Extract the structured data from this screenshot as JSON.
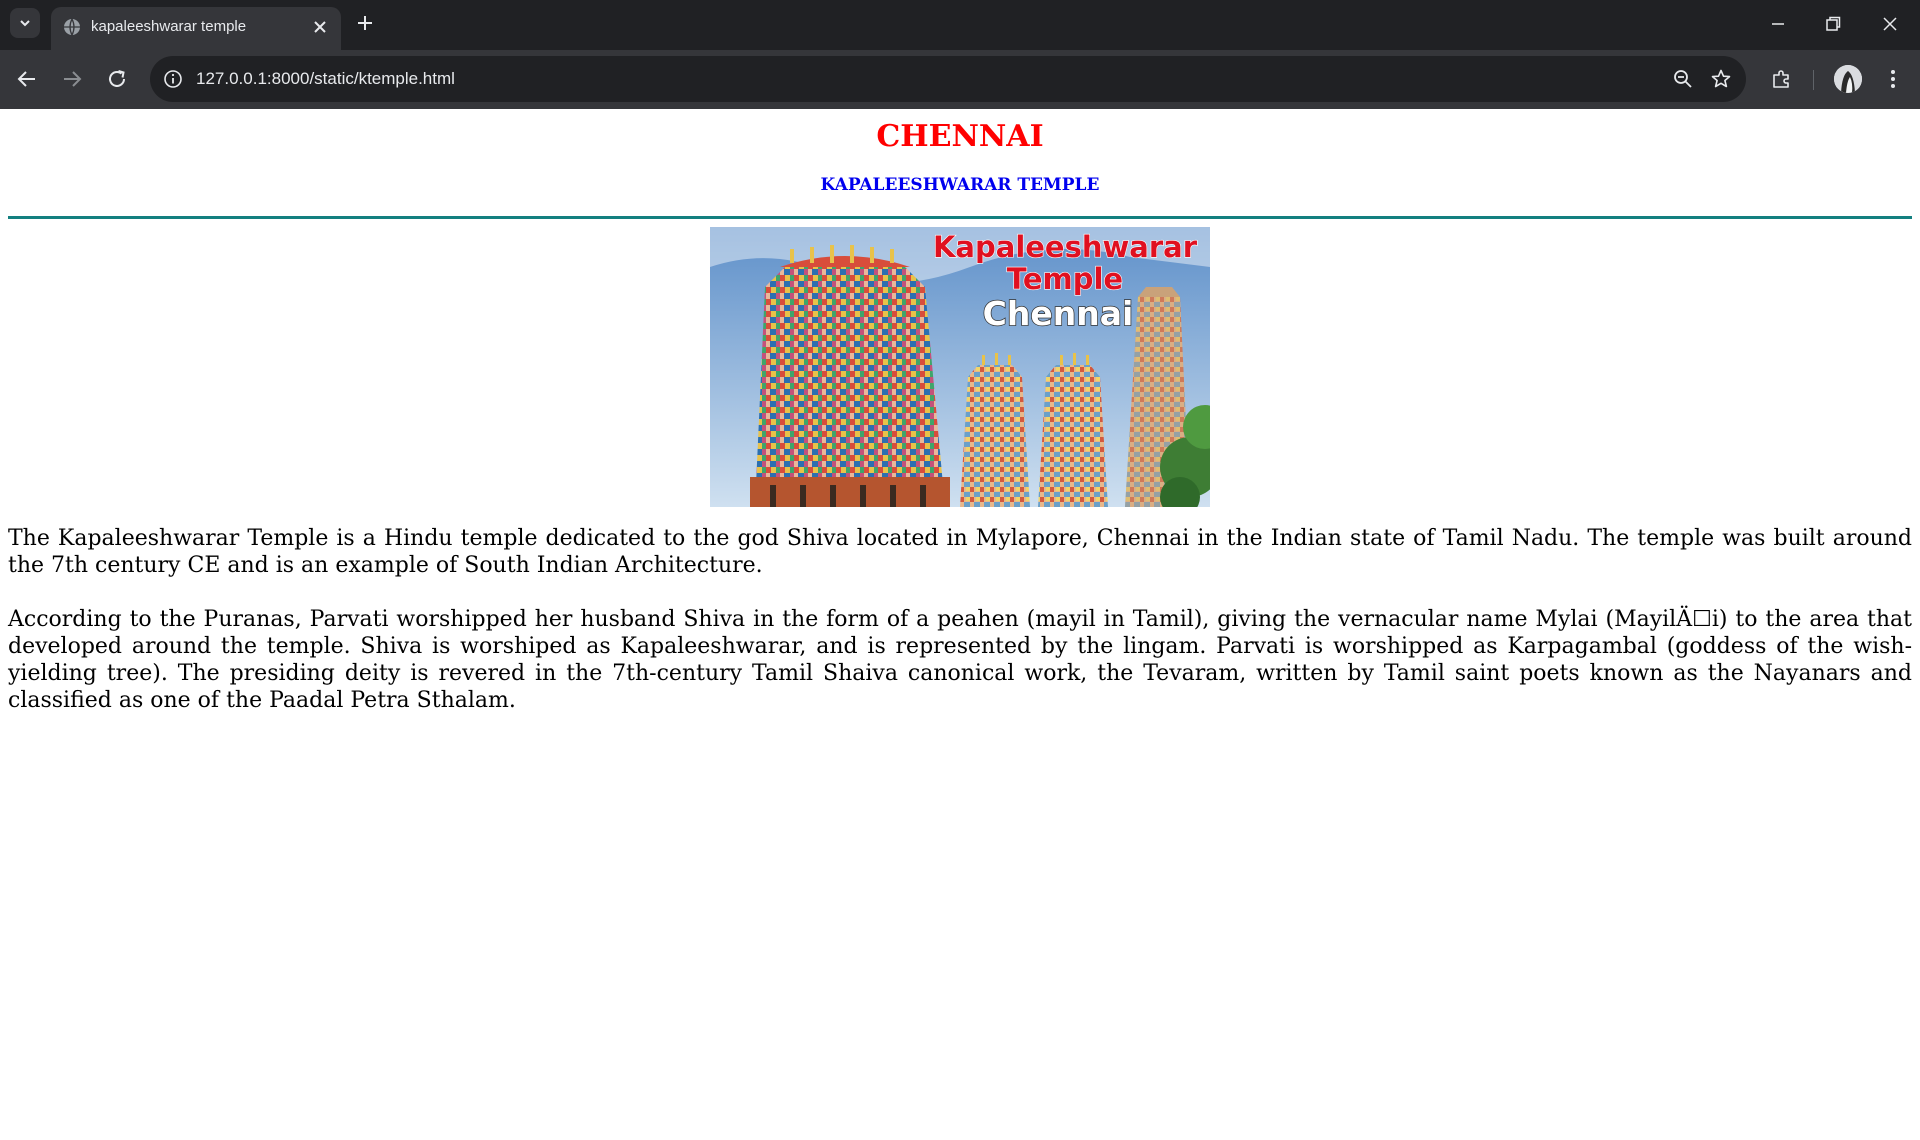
{
  "browser": {
    "tab_title": "kapaleeshwarar temple",
    "url": "127.0.0.1:8000/static/ktemple.html",
    "icons": {
      "tab_search": "chevron-down-icon",
      "favicon": "globe-icon",
      "tab_close": "close-icon",
      "new_tab": "plus-icon",
      "minimize": "minimize-icon",
      "restore": "restore-icon",
      "window_close": "close-icon",
      "back": "arrow-left-icon",
      "forward": "arrow-right-icon",
      "reload": "reload-icon",
      "site_info": "info-icon",
      "zoom": "zoom-out-icon",
      "bookmark": "star-icon",
      "extensions": "puzzle-icon",
      "profile": "avatar",
      "menu": "kebab-menu-icon"
    }
  },
  "page": {
    "heading": "CHENNAI",
    "subheading": "KAPALEESHWARAR TEMPLE",
    "image": {
      "title_line1": "Kapaleeshwarar",
      "title_line2": "Temple",
      "subtitle": "Chennai"
    },
    "paragraphs": [
      "The Kapaleeshwarar Temple is a Hindu temple dedicated to the god Shiva located in Mylapore, Chennai in the Indian state of Tamil Nadu. The temple was built around the 7th century CE and is an example of South Indian Architecture.",
      "According to the Puranas, Parvati worshipped her husband Shiva in the form of a peahen (mayil in Tamil), giving the vernacular name Mylai (MayilÄ☐i) to the area that developed around the temple. Shiva is worshiped as Kapaleeshwarar, and is represented by the lingam. Parvati is worshipped as Karpagambal (goddess of the wish-yielding tree). The presiding deity is revered in the 7th-century Tamil Shaiva canonical work, the Tevaram, written by Tamil saint poets known as the Nayanars and classified as one of the Paadal Petra Sthalam."
    ],
    "colors": {
      "heading": "#ff0000",
      "subheading": "#0000ee",
      "rule": "#138080"
    }
  }
}
